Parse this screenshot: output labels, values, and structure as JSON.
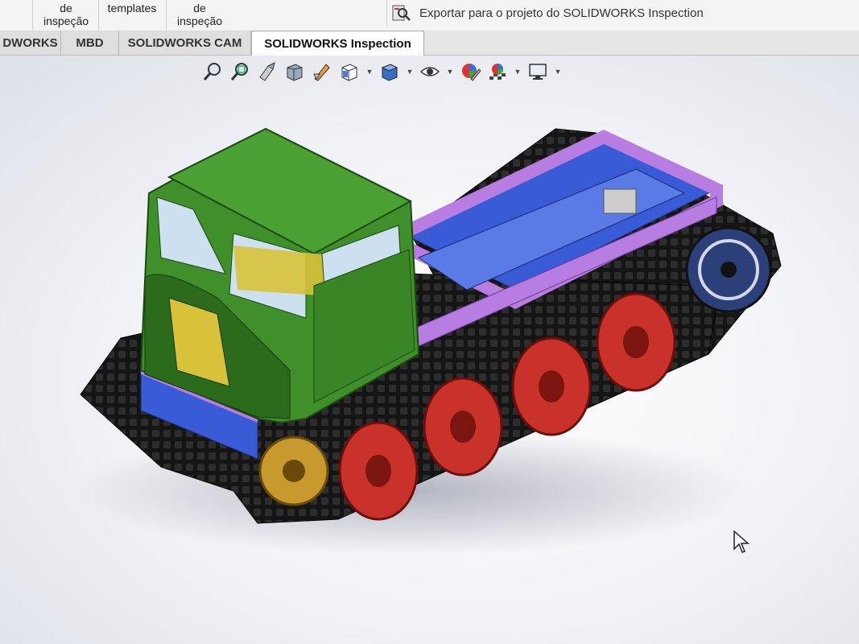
{
  "ribbon": {
    "cell1_line1": "de",
    "cell1_line2": "inspeção",
    "cell2_line1": "templates",
    "cell3_line1": "de",
    "cell3_line2": "inspeção",
    "export_label": "Exportar para o projeto do SOLIDWORKS Inspection",
    "export_icon": "export-inspection-icon"
  },
  "tabs": [
    {
      "label": "DWORKS"
    },
    {
      "label": "MBD"
    },
    {
      "label": "SOLIDWORKS CAM"
    },
    {
      "label": "SOLIDWORKS Inspection",
      "active": true
    }
  ],
  "heads_up_toolbar": {
    "icons": [
      "zoom-to-fit-icon",
      "zoom-to-area-icon",
      "previous-view-icon",
      "section-view-icon",
      "dynamic-annotation-icon",
      "view-orientation-icon",
      "display-style-icon",
      "hide-show-icon",
      "edit-appearance-icon",
      "apply-scene-icon",
      "view-settings-icon"
    ]
  },
  "colors": {
    "cab": "#3f8f2a",
    "cab_dark": "#2c6a1c",
    "frame": "#b77de0",
    "bed": "#3a5bd6",
    "wheels": "#c8322a",
    "sprocket": "#c89a2e",
    "track": "#1a1a1a",
    "interior": "#d8c23a"
  }
}
